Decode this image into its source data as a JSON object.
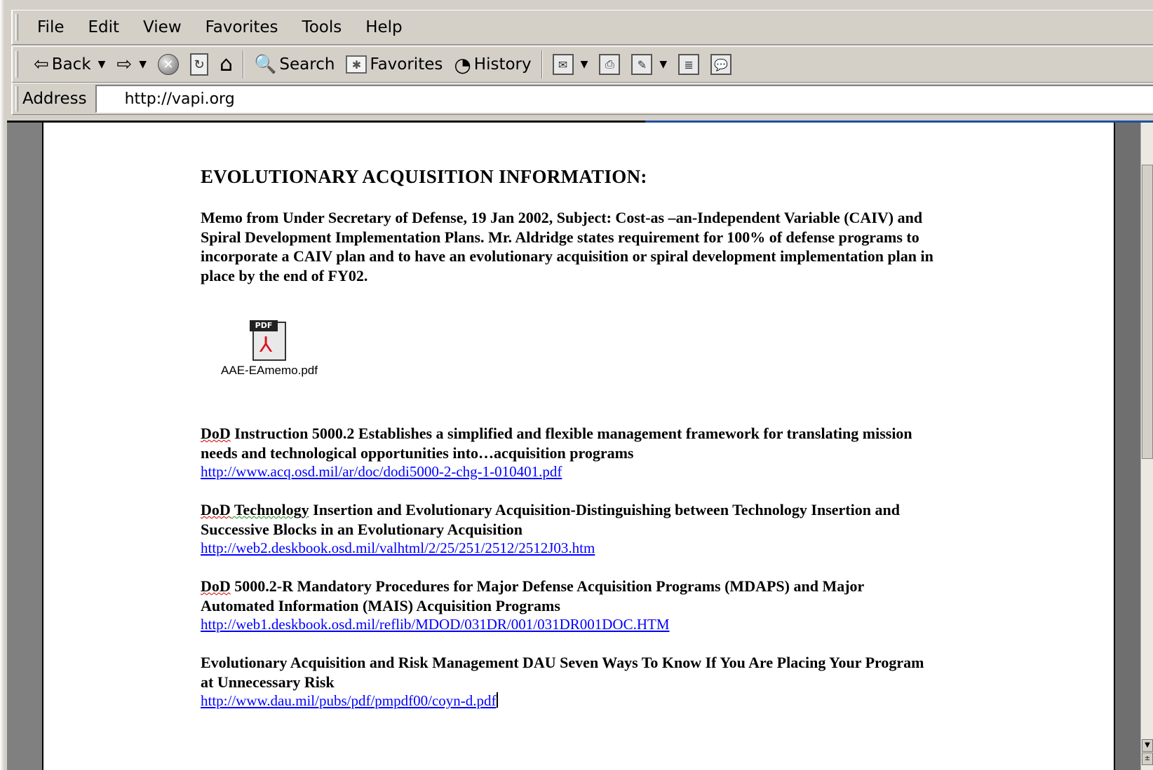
{
  "menu": {
    "items": [
      {
        "label": "File"
      },
      {
        "label": "Edit"
      },
      {
        "label": "View"
      },
      {
        "label": "Favorites"
      },
      {
        "label": "Tools"
      },
      {
        "label": "Help"
      }
    ]
  },
  "toolbar": {
    "back_label": "Back",
    "search_label": "Search",
    "favorites_label": "Favorites",
    "history_label": "History"
  },
  "address": {
    "label": "Address",
    "value": "http://vapi.org"
  },
  "document": {
    "heading": "EVOLUTIONARY ACQUISITION INFORMATION:",
    "memo": "Memo from Under Secretary of Defense, 19 Jan 2002, Subject: Cost-as –an-Independent Variable (CAIV) and Spiral Development Implementation Plans.   Mr. Aldridge states requirement for 100% of defense programs to incorporate a CAIV plan and to have an evolutionary acquisition or spiral development implementation plan in place by the end of FY02.",
    "attachment": {
      "badge": "PDF",
      "filename": "AAE-EAmemo.pdf"
    },
    "entries": [
      {
        "prefix": "DoD",
        "text": " Instruction 5000.2     Establishes a simplified and flexible management framework for translating mission needs and technological opportunities into…acquisition programs",
        "link": "http://www.acq.osd.mil/ar/doc/dodi5000-2-chg-1-010401.pdf"
      },
      {
        "prefix": "DoD",
        "middle": "  Technology",
        "text": " Insertion and Evolutionary Acquisition-Distinguishing between Technology Insertion and Successive Blocks in an Evolutionary Acquisition",
        "link": "http://web2.deskbook.osd.mil/valhtml/2/25/251/2512/2512J03.htm"
      },
      {
        "prefix": "DoD",
        "text": " 5000.2-R     Mandatory Procedures for Major Defense Acquisition Programs (MDAPS) and Major Automated Information (MAIS) Acquisition Programs",
        "link": "http://web1.deskbook.osd.mil/reflib/MDOD/031DR/001/031DR001DOC.HTM"
      },
      {
        "text": "Evolutionary Acquisition and Risk Management DAU    Seven Ways To Know If You Are Placing Your Program at Unnecessary Risk",
        "link": "http://www.dau.mil/pubs/pdf/pmpdf00/coyn-d.pdf"
      }
    ]
  }
}
